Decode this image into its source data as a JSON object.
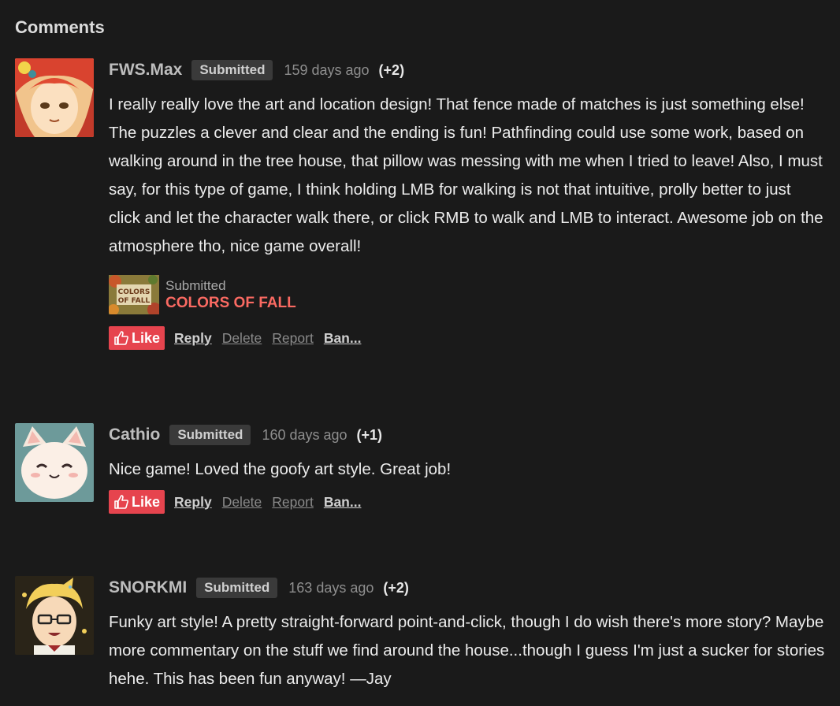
{
  "section": {
    "title": "Comments"
  },
  "comments": [
    {
      "author": "FWS.Max",
      "badge": "Submitted",
      "date": "159 days ago",
      "votes": "(+2)",
      "text": "I really really love the art and location design! That fence made of matches is just something else! The puzzles a clever and clear and the ending is fun! Pathfinding could use some work, based on walking around in the tree house, that pillow was messing with me when I tried to leave! Also, I must say, for this type of game, I think holding LMB for walking is not that intuitive, prolly better to just click and let the character walk there, or click RMB to walk and LMB to interact. Awesome job on the atmosphere tho, nice game overall!",
      "submission": {
        "label": "Submitted",
        "title": "COLORS OF FALL",
        "thumb_text_line1": "COLORS",
        "thumb_text_line2": "OF FALL"
      },
      "actions": {
        "like": "Like",
        "reply": "Reply",
        "delete": "Delete",
        "report": "Report",
        "ban": "Ban..."
      }
    },
    {
      "author": "Cathio",
      "badge": "Submitted",
      "date": "160 days ago",
      "votes": "(+1)",
      "text": "Nice game! Loved the goofy art style. Great job!",
      "actions": {
        "like": "Like",
        "reply": "Reply",
        "delete": "Delete",
        "report": "Report",
        "ban": "Ban..."
      }
    },
    {
      "author": "SNORKMI",
      "badge": "Submitted",
      "date": "163 days ago",
      "votes": "(+2)",
      "text": "Funky art style! A pretty straight-forward point-and-click, though I do wish there's more story? Maybe more commentary on the stuff we find around the house...though I guess I'm just a sucker for stories hehe. This has been fun anyway! —Jay"
    }
  ],
  "colors": {
    "background": "#1a1a1a",
    "accent_like": "#e6444e",
    "submission_title": "#fa6a62"
  }
}
